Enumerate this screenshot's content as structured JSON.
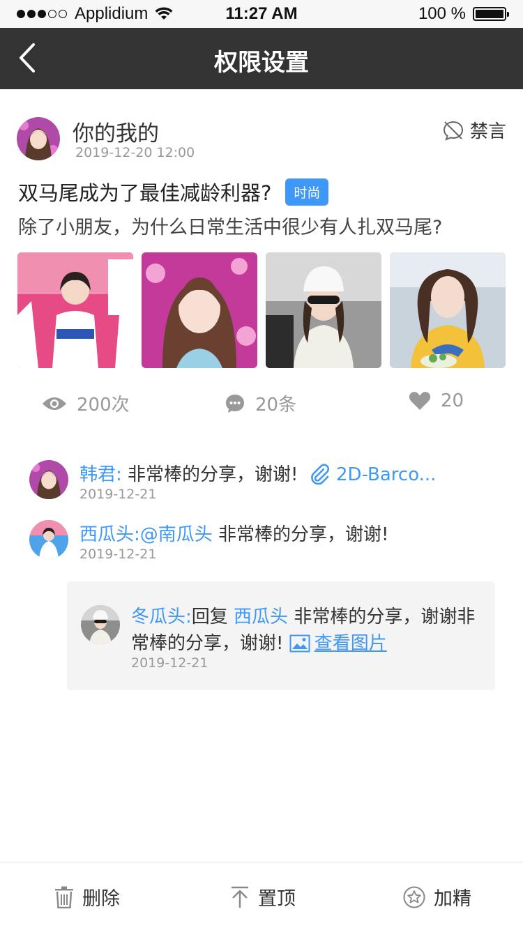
{
  "status_bar": {
    "carrier": "Applidium",
    "time": "11:27 AM",
    "battery": "100 %"
  },
  "nav": {
    "title": "权限设置",
    "back_icon": "chevron-left-icon"
  },
  "post": {
    "author": "你的我的",
    "time": "2019-12-20 12:00",
    "mute_label": "禁言",
    "title": "双马尾成为了最佳减龄利器?",
    "tag": "时尚",
    "subtitle": "除了小朋友，为什么日常生活中很少有人扎双马尾?",
    "photos": [
      "photo-1",
      "photo-2",
      "photo-3",
      "photo-4"
    ]
  },
  "stats": {
    "views": "200次",
    "comments": "20条",
    "likes": "20"
  },
  "comments": [
    {
      "name": "韩君:",
      "text": "非常棒的分享，谢谢!",
      "attachment": "2D-Barco...",
      "date": "2019-12-21"
    },
    {
      "name": "西瓜头:",
      "mention": "@南瓜头",
      "text": "非常棒的分享，谢谢!",
      "date": "2019-12-21"
    }
  ],
  "reply": {
    "name": "冬瓜头:",
    "reply_word": "回复",
    "reply_to": "西瓜头",
    "text": "非常棒的分享，谢谢非常棒的分享，谢谢!",
    "image_link": "查看图片",
    "date": "2019-12-21"
  },
  "bottom_bar": {
    "delete": "删除",
    "pin": "置顶",
    "feature": "加精"
  },
  "colors": {
    "accent": "#3f98f5",
    "nav_bg": "#333333"
  }
}
